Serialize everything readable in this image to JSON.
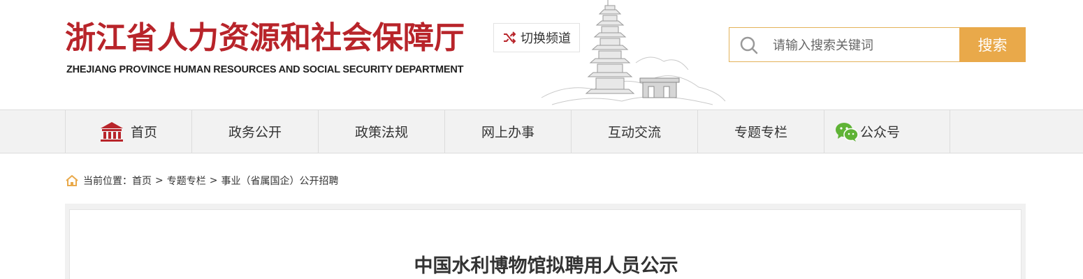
{
  "header": {
    "logo_cn": "浙江省人力资源和社会保障厅",
    "logo_en": "ZHEJIANG PROVINCE HUMAN RESOURCES AND SOCIAL SECURITY DEPARTMENT",
    "switch_label": "切换频道",
    "search_placeholder": "请输入搜索关键词",
    "search_button": "搜索",
    "accent_color": "#e9a94a",
    "brand_color": "#b8242a"
  },
  "nav": {
    "items": [
      {
        "label": "首页",
        "icon": "bank-icon"
      },
      {
        "label": "政务公开"
      },
      {
        "label": "政策法规"
      },
      {
        "label": "网上办事"
      },
      {
        "label": "互动交流"
      },
      {
        "label": "专题专栏"
      },
      {
        "label": "公众号",
        "icon": "wechat-icon"
      }
    ]
  },
  "breadcrumb": {
    "prefix": "当前位置：",
    "items": [
      "首页",
      "专题专栏",
      "事业（省属国企）公开招聘"
    ],
    "separator": ">"
  },
  "article": {
    "title": "中国水利博物馆拟聘用人员公示"
  }
}
